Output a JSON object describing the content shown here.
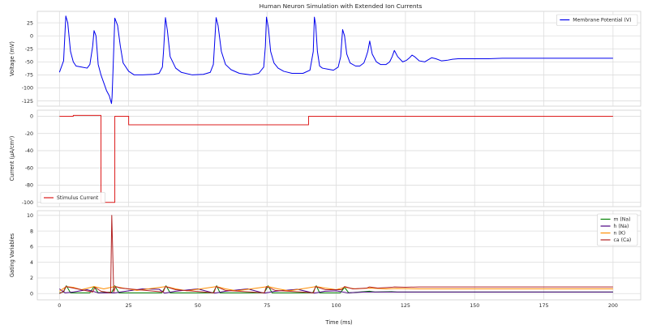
{
  "chart_data": [
    {
      "type": "line",
      "title": "Human Neuron Simulation with Extended Ion Currents",
      "xlabel": "",
      "ylabel": "Voltage (mV)",
      "xlim": [
        -8,
        210
      ],
      "ylim": [
        -135,
        47
      ],
      "xticks": [
        0,
        25,
        50,
        75,
        100,
        125,
        150,
        175,
        200
      ],
      "xticklabels": [],
      "yticks": [
        25,
        0,
        -25,
        -50,
        -75,
        -100,
        -125
      ],
      "grid": true,
      "legend_position": "upper right",
      "series": [
        {
          "name": "Membrane Potential (V)",
          "color": "#0000ee",
          "x": [
            0,
            1.5,
            2.3,
            3,
            4,
            5,
            6,
            8,
            10,
            11,
            12,
            12.5,
            13.2,
            14,
            15,
            16,
            17,
            18,
            18.8,
            19,
            19.4,
            20,
            21,
            22,
            23,
            25,
            27,
            30,
            34,
            36,
            37.2,
            37.6,
            38.3,
            39,
            40,
            42,
            44,
            48,
            52,
            54.5,
            55.6,
            56,
            56.6,
            57.3,
            58.5,
            60,
            62,
            65,
            69,
            72,
            73.8,
            74.4,
            74.8,
            75.5,
            76.3,
            77.5,
            79,
            81,
            84,
            88,
            90.5,
            91.7,
            92.1,
            92.6,
            93.2,
            94,
            95,
            97,
            99,
            100.7,
            101.6,
            102.3,
            103,
            103.8,
            105,
            107,
            108.5,
            110,
            110.8,
            111.4,
            112.1,
            113,
            114.5,
            116,
            118,
            119.3,
            120.2,
            121,
            122.2,
            124,
            125.4,
            126.5,
            127.4,
            128.3,
            130,
            132,
            133.2,
            134.5,
            136,
            138,
            140,
            142,
            144,
            147,
            150,
            155,
            160,
            170,
            180,
            190,
            200
          ],
          "values": [
            -70,
            -48,
            38,
            25,
            -30,
            -50,
            -58,
            -60,
            -62,
            -55,
            -20,
            10,
            0,
            -55,
            -75,
            -90,
            -105,
            -115,
            -130,
            -118,
            -60,
            34,
            20,
            -20,
            -52,
            -68,
            -75,
            -75,
            -74,
            -72,
            -60,
            -30,
            35,
            10,
            -40,
            -62,
            -70,
            -75,
            -74,
            -70,
            -55,
            -20,
            35,
            20,
            -30,
            -55,
            -65,
            -72,
            -75,
            -72,
            -60,
            -20,
            36,
            15,
            -30,
            -52,
            -62,
            -68,
            -72,
            -72,
            -66,
            -30,
            36,
            20,
            -30,
            -58,
            -62,
            -64,
            -66,
            -60,
            -40,
            12,
            0,
            -35,
            -52,
            -58,
            -58,
            -52,
            -40,
            -30,
            -10,
            -35,
            -50,
            -55,
            -55,
            -50,
            -40,
            -28,
            -40,
            -50,
            -47,
            -42,
            -37,
            -40,
            -48,
            -50,
            -46,
            -42,
            -44,
            -48,
            -47,
            -45,
            -44,
            -44,
            -44,
            -44,
            -43,
            -43,
            -43,
            -43,
            -43
          ]
        }
      ]
    },
    {
      "type": "line",
      "title": "",
      "xlabel": "",
      "ylabel": "Current (µA/cm²)",
      "xlim": [
        -8,
        210
      ],
      "ylim": [
        -105,
        7
      ],
      "xticks": [
        0,
        25,
        50,
        75,
        100,
        125,
        150,
        175,
        200
      ],
      "xticklabels": [],
      "yticks": [
        0,
        -20,
        -40,
        -60,
        -80,
        -100
      ],
      "grid": true,
      "legend_position": "lower left",
      "series": [
        {
          "name": "Stimulus Current",
          "color": "#dd1c1c",
          "x": [
            0,
            5,
            5,
            15,
            15,
            20,
            20,
            25,
            25,
            90,
            90,
            200
          ],
          "values": [
            0,
            0,
            1,
            1,
            -100,
            -100,
            0,
            0,
            -10,
            -10,
            0,
            0
          ]
        }
      ]
    },
    {
      "type": "line",
      "title": "",
      "xlabel": "Time (ms)",
      "ylabel": "Gating Variables",
      "xlim": [
        -8,
        210
      ],
      "ylim": [
        -0.8,
        10.6
      ],
      "xticks": [
        0,
        25,
        50,
        75,
        100,
        125,
        150,
        175,
        200
      ],
      "xticklabels": [
        "0",
        "25",
        "50",
        "75",
        "100",
        "125",
        "150",
        "175",
        "200"
      ],
      "yticks": [
        0,
        2,
        4,
        6,
        8,
        10
      ],
      "grid": true,
      "legend_position": "upper right",
      "series": [
        {
          "name": "m (Na)",
          "color": "#008000",
          "x": [
            0,
            1.5,
            2.5,
            4,
            11,
            12.5,
            14,
            19,
            20,
            21.5,
            37,
            38.5,
            40,
            55.5,
            56.8,
            58,
            74,
            75.4,
            76.8,
            91.5,
            92.8,
            94,
            101.5,
            103,
            104.5,
            112,
            114,
            120,
            122,
            130,
            200
          ],
          "values": [
            0.1,
            0.2,
            1.0,
            0.1,
            0.1,
            0.9,
            0.1,
            0.2,
            1.0,
            0.1,
            0.1,
            1.0,
            0.1,
            0.1,
            1.0,
            0.1,
            0.1,
            1.0,
            0.1,
            0.1,
            1.0,
            0.1,
            0.1,
            0.8,
            0.1,
            0.3,
            0.2,
            0.25,
            0.2,
            0.2,
            0.2
          ]
        },
        {
          "name": "h (Na)",
          "color": "#4b0082",
          "x": [
            0,
            2,
            5,
            10,
            14,
            20,
            24,
            30,
            36,
            38,
            42,
            50,
            56,
            60,
            68,
            74,
            78,
            86,
            92,
            96,
            100,
            104,
            110,
            120,
            130,
            150,
            200
          ],
          "values": [
            0.6,
            0.1,
            0.2,
            0.5,
            0.1,
            0.1,
            0.3,
            0.6,
            0.55,
            0.05,
            0.3,
            0.6,
            0.05,
            0.3,
            0.6,
            0.05,
            0.3,
            0.55,
            0.05,
            0.3,
            0.35,
            0.1,
            0.2,
            0.2,
            0.2,
            0.2,
            0.2
          ]
        },
        {
          "name": "n (K)",
          "color": "#ff8c00",
          "x": [
            0,
            2.5,
            5,
            8,
            12.5,
            16,
            20,
            23,
            28,
            38.5,
            42,
            46,
            56.8,
            60,
            64,
            75.4,
            79,
            83,
            92.8,
            96,
            100,
            103,
            107,
            112,
            118,
            122,
            130,
            140,
            200
          ],
          "values": [
            0.3,
            0.9,
            0.8,
            0.5,
            0.9,
            0.6,
            0.9,
            0.7,
            0.4,
            0.9,
            0.6,
            0.35,
            0.9,
            0.6,
            0.35,
            0.9,
            0.6,
            0.35,
            0.9,
            0.7,
            0.5,
            0.8,
            0.6,
            0.7,
            0.6,
            0.65,
            0.6,
            0.6,
            0.6
          ]
        },
        {
          "name": "ca (Ca)",
          "color": "#b22222",
          "x": [
            0,
            1.5,
            2.3,
            5,
            12,
            12.8,
            15,
            18.5,
            18.9,
            19.2,
            19.6,
            20.3,
            22,
            37.5,
            38.3,
            42,
            55.8,
            56.6,
            60,
            74,
            74.8,
            78,
            91.8,
            92.5,
            96,
            102,
            103,
            106,
            111,
            112,
            115,
            120,
            121,
            125,
            130,
            140,
            200
          ],
          "values": [
            0.0,
            0.3,
            0.9,
            0.7,
            0.2,
            0.8,
            0.3,
            0.1,
            10.0,
            6.0,
            0.2,
            0.9,
            0.7,
            0.2,
            0.9,
            0.5,
            0.1,
            0.9,
            0.4,
            0.1,
            0.9,
            0.4,
            0.1,
            0.9,
            0.5,
            0.5,
            0.9,
            0.6,
            0.7,
            0.85,
            0.7,
            0.8,
            0.85,
            0.8,
            0.85,
            0.85,
            0.85
          ]
        }
      ]
    }
  ]
}
